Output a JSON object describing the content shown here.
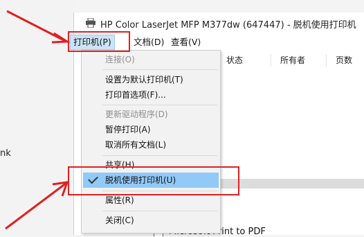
{
  "background": {
    "left_text": "nk"
  },
  "window": {
    "title": "HP Color LaserJet MFP M377dw (647447)  -  脱机使用打印机"
  },
  "menubar": {
    "items": [
      {
        "label": "打印机(P)",
        "active": true
      },
      {
        "label": "文档(D)",
        "active": false
      },
      {
        "label": "查看(V)",
        "active": false
      }
    ]
  },
  "queue": {
    "columns": [
      "状态",
      "所有者",
      "页数"
    ]
  },
  "printer_list": {
    "item": "Microsoft Print to PDF"
  },
  "dropdown": {
    "connect": "连接(O)",
    "set_default": "设置为默认打印机(T)",
    "print_prefs": "打印首选项(F)...",
    "update_driver": "更新驱动程序(D)",
    "pause": "暂停打印(A)",
    "cancel_all": "取消所有文档(L)",
    "share": "共享(H)...",
    "offline": "脱机使用打印机(U)",
    "offline_checked": true,
    "properties": "属性(R)",
    "close": "关闭(C)"
  },
  "colors": {
    "annotation": "#e02020",
    "highlight": "#91c9f7",
    "menu_active": "#cce4f7"
  }
}
